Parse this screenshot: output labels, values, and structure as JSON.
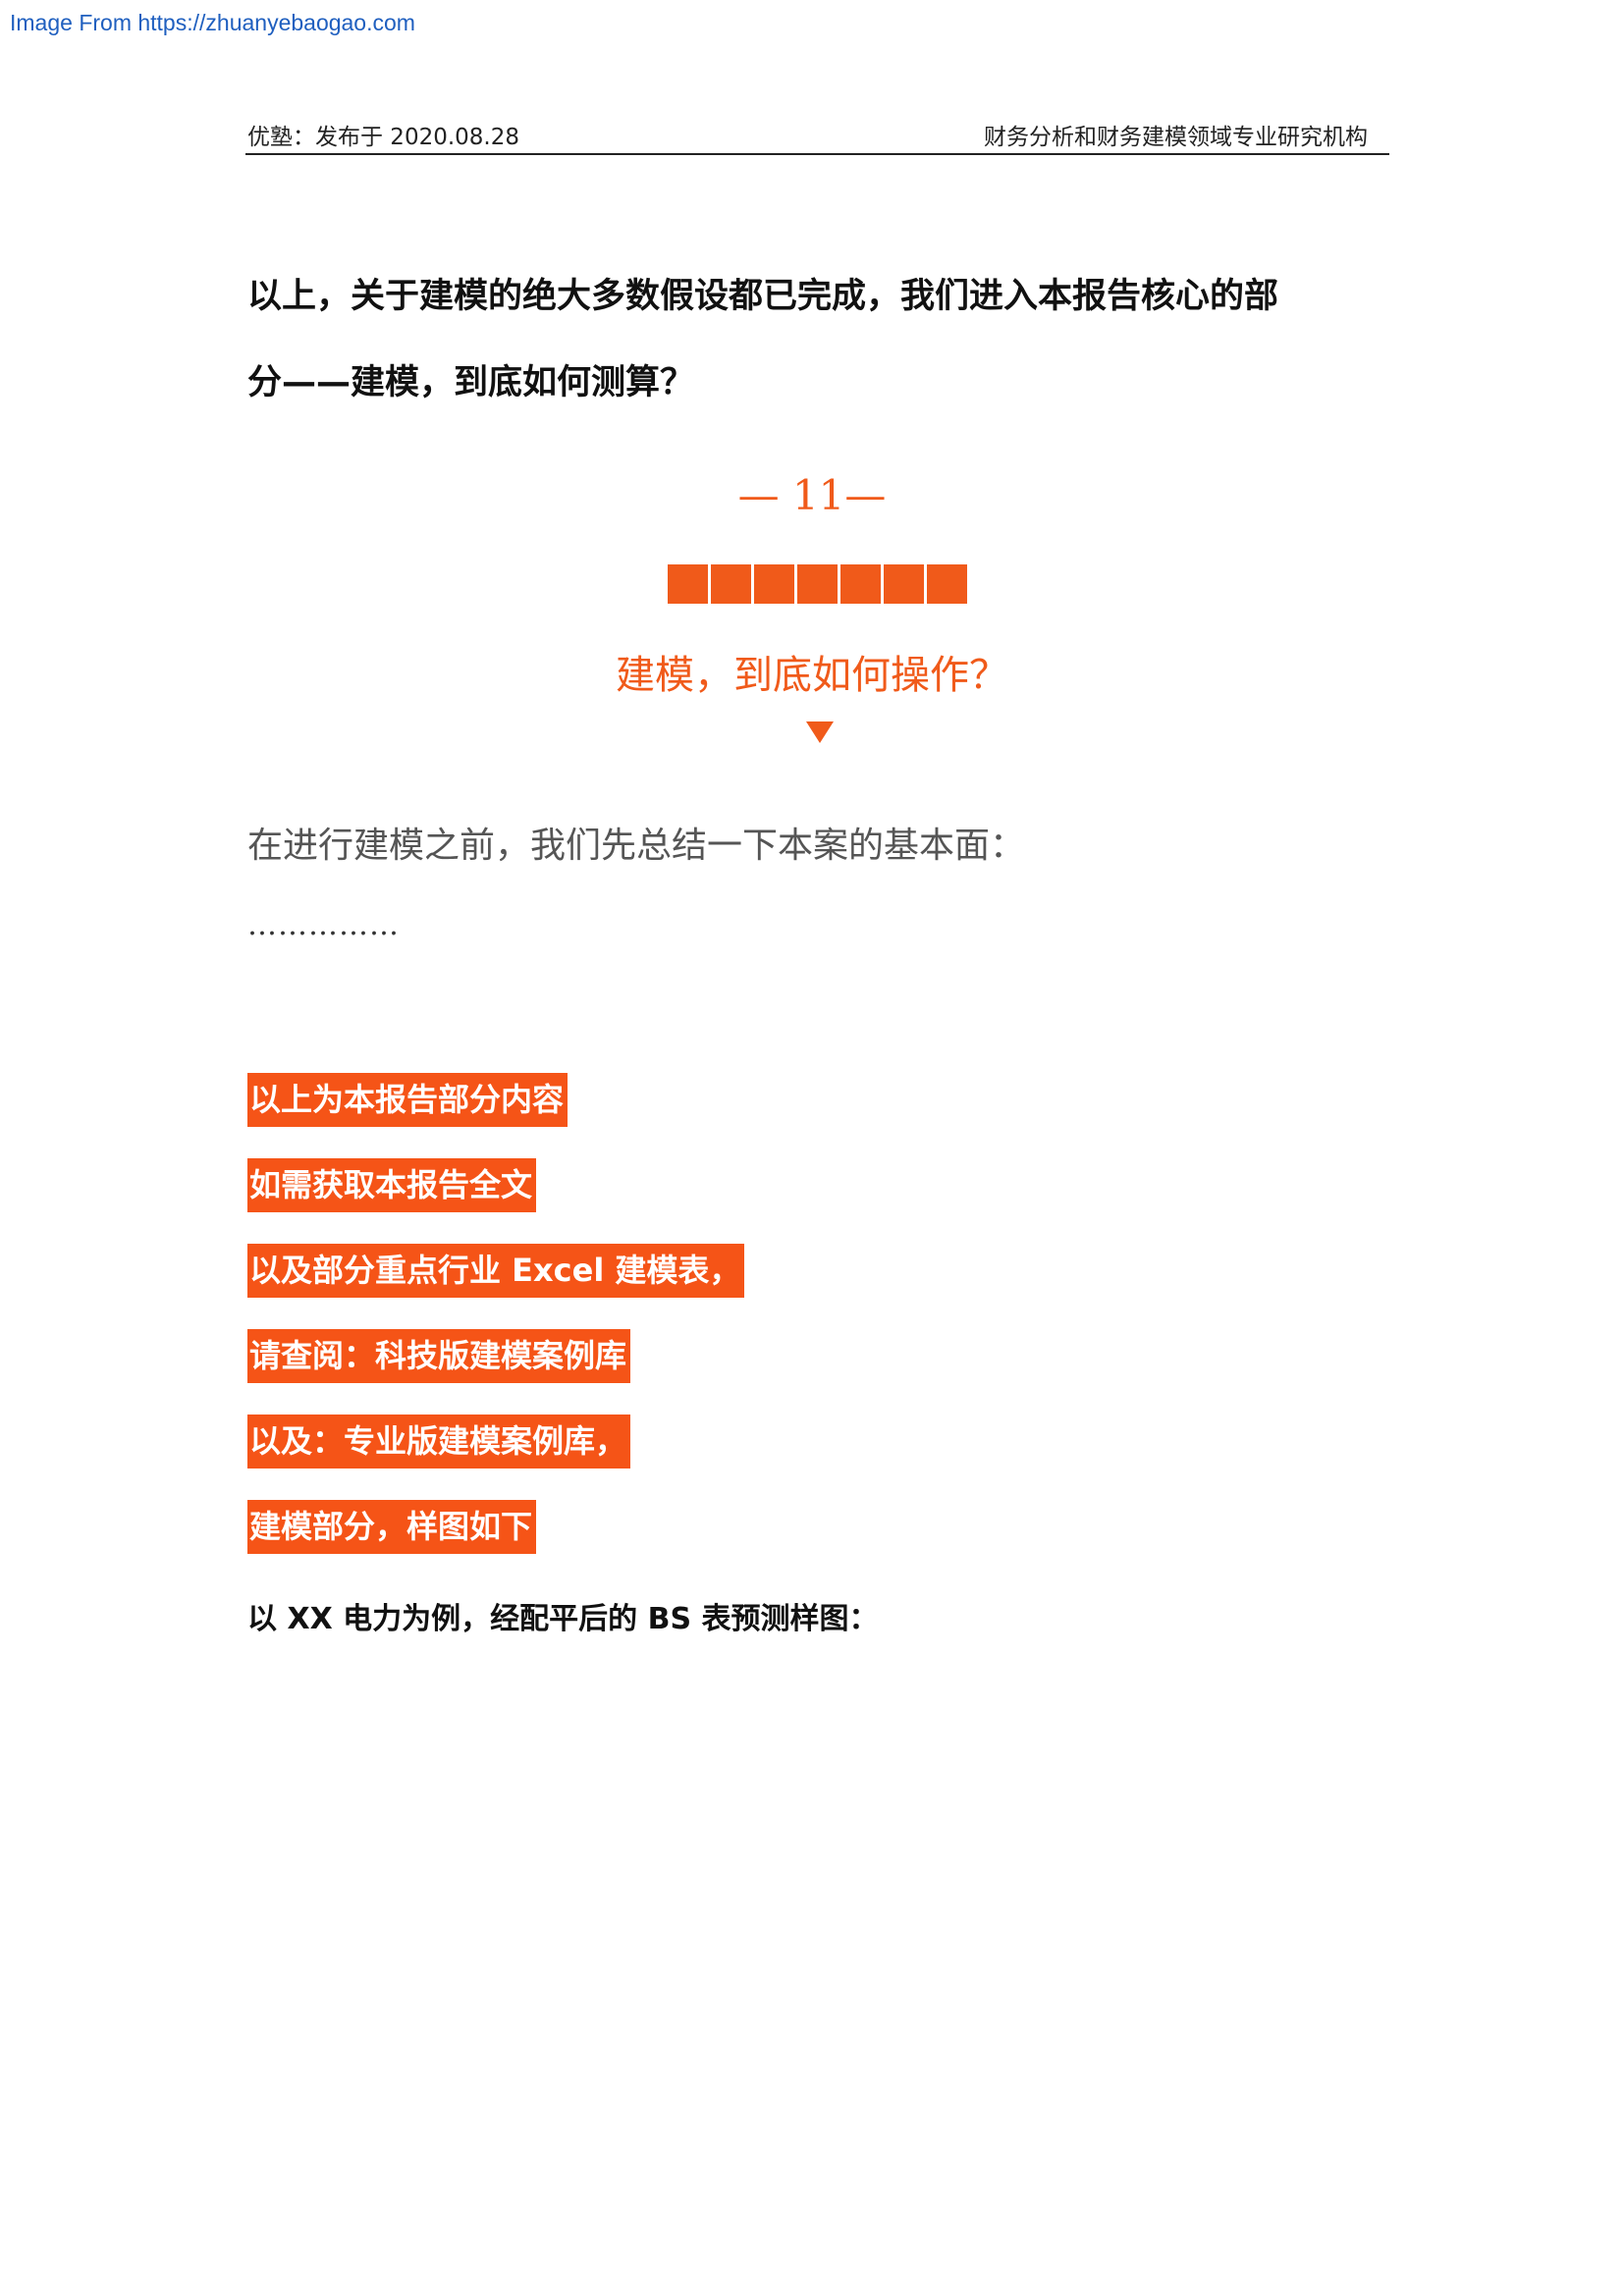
{
  "source": {
    "text": "Image From https://zhuanyebaogao.com"
  },
  "header": {
    "left": "优塾：发布于 2020.08.28",
    "right": "财务分析和财务建模领域专业研究机构"
  },
  "intro": {
    "line1": "以上，关于建模的绝大多数假设都已完成，我们进入本报告核心的部",
    "line2": "分——建模，到底如何测算？"
  },
  "section": {
    "number": "— 11—",
    "title": "建模，到底如何操作？",
    "accent_color": "#f05a1a",
    "block_count": 7,
    "arrow_icon": "down-triangle-icon"
  },
  "summary": {
    "text": "在进行建模之前，我们先总结一下本案的基本面：",
    "ellipsis": "……………"
  },
  "highlights": [
    "以上为本报告部分内容",
    "如需获取本报告全文",
    "以及部分重点行业 Excel 建模表，",
    "请查阅：科技版建模案例库",
    "以及：专业版建模案例库，",
    "建模部分，样图如下"
  ],
  "highlight_color": "#f55417",
  "example": {
    "text": "以 XX 电力为例，经配平后的 BS 表预测样图："
  }
}
